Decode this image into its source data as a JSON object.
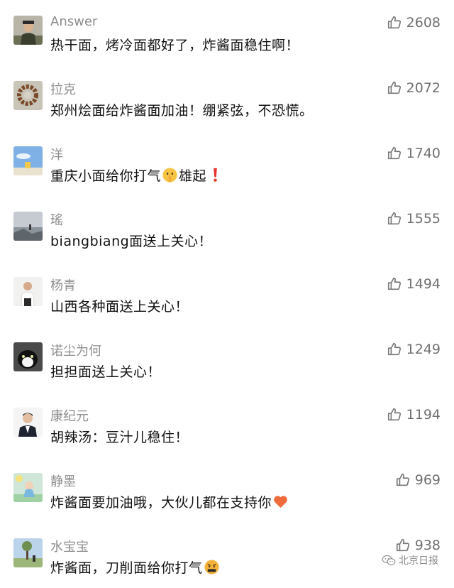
{
  "comments": [
    {
      "name": "Answer",
      "text": "热干面，烤冷面都好了，炸酱面稳住啊！",
      "likes": "2608",
      "avatar": "avatar-man-hat",
      "emoji": []
    },
    {
      "name": "拉克",
      "text": "郑州烩面给炸酱面加油！绷紧弦，不恐慌。",
      "likes": "2072",
      "avatar": "avatar-bead-bracelet",
      "emoji": []
    },
    {
      "name": "洋",
      "text": "重庆小面给你打气",
      "text_after": "雄起",
      "likes": "1740",
      "avatar": "avatar-sky",
      "emoji": [
        "shushing-face-emoji",
        "exclamation-emoji"
      ]
    },
    {
      "name": "瑤",
      "text": "biangbiang面送上关心！",
      "likes": "1555",
      "avatar": "avatar-sea-rocks",
      "emoji": []
    },
    {
      "name": "杨青",
      "text": "山西各种面送上关心！",
      "likes": "1494",
      "avatar": "avatar-person-white-shirt",
      "emoji": []
    },
    {
      "name": "诺尘为何",
      "text": "担担面送上关心！",
      "likes": "1249",
      "avatar": "avatar-black-white-cat",
      "emoji": []
    },
    {
      "name": "康纪元",
      "text": "胡辣汤：豆汁儿稳住！",
      "likes": "1194",
      "avatar": "avatar-man-suit",
      "emoji": []
    },
    {
      "name": "静墨",
      "text": "炸酱面要加油哦，大伙儿都在支持你",
      "likes": "969",
      "avatar": "avatar-cartoon-girl",
      "emoji": [
        "heart-emoji"
      ]
    },
    {
      "name": "水宝宝",
      "text": "炸酱面，刀削面给你打气",
      "likes": "938",
      "avatar": "avatar-tree-field",
      "emoji": [
        "cursing-face-emoji"
      ]
    }
  ],
  "watermark": {
    "text": "北京日报",
    "icon": "wechat-icon"
  },
  "colors": {
    "name": "#8e8e8e",
    "text": "#111111",
    "likes": "#707070",
    "heart": "#ef6b3b",
    "exclaim": "#e5352c"
  }
}
